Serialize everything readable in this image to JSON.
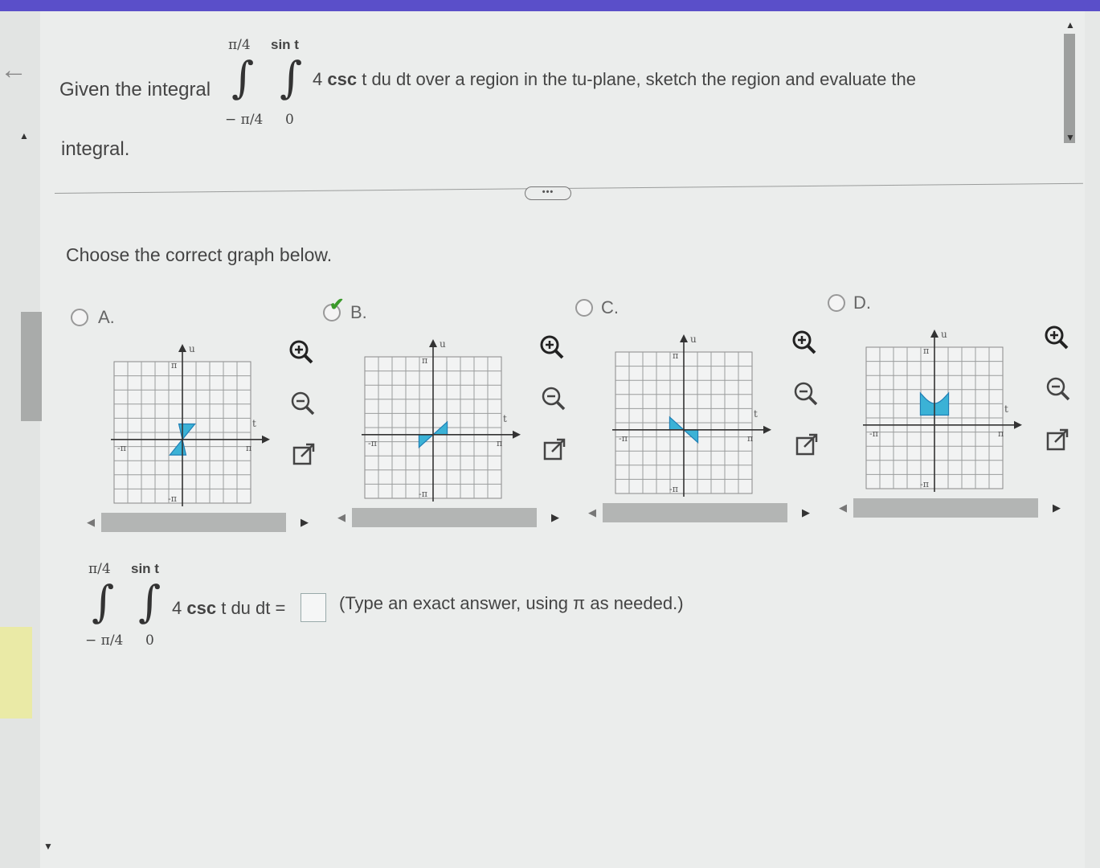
{
  "question": {
    "prefix": "Given the integral",
    "upper_outer": "π/4",
    "upper_inner": "sin t",
    "lower_outer": "− π/4",
    "lower_inner": "0",
    "integrand_coef": "4",
    "integrand_func": "csc",
    "integrand_rest": "t du dt over a region in the tu-plane, sketch the region and evaluate the",
    "wrap": "integral."
  },
  "more_button": "•••",
  "prompt": "Choose the correct graph below.",
  "options": [
    {
      "letter": "A.",
      "selected": false,
      "axis_top": "u",
      "axis_right": "t",
      "tick_pi": "π",
      "tick_neg_pi": "-π",
      "shaded_color": "#3bb2d6"
    },
    {
      "letter": "B.",
      "selected": true,
      "axis_top": "u",
      "axis_right": "t",
      "tick_pi": "π",
      "tick_neg_pi": "-π",
      "shaded_color": "#3bb2d6"
    },
    {
      "letter": "C.",
      "selected": false,
      "axis_top": "u",
      "axis_right": "t",
      "tick_pi": "π",
      "tick_neg_pi": "-π",
      "shaded_color": "#3bb2d6"
    },
    {
      "letter": "D.",
      "selected": false,
      "axis_top": "u",
      "axis_right": "t",
      "tick_pi": "π",
      "tick_neg_pi": "-π",
      "shaded_color": "#3bb2d6"
    }
  ],
  "answer": {
    "upper_outer": "π/4",
    "upper_inner": "sin t",
    "lower_outer": "− π/4",
    "lower_inner": "0",
    "integrand_coef": "4",
    "integrand_func": "csc",
    "integrand_rest": "t du dt =",
    "value": "",
    "hint": "(Type an exact answer, using π as needed.)"
  },
  "icons": {
    "zoom_in": "zoom-in-icon",
    "zoom_out": "zoom-out-icon",
    "popout": "external-link-icon"
  }
}
